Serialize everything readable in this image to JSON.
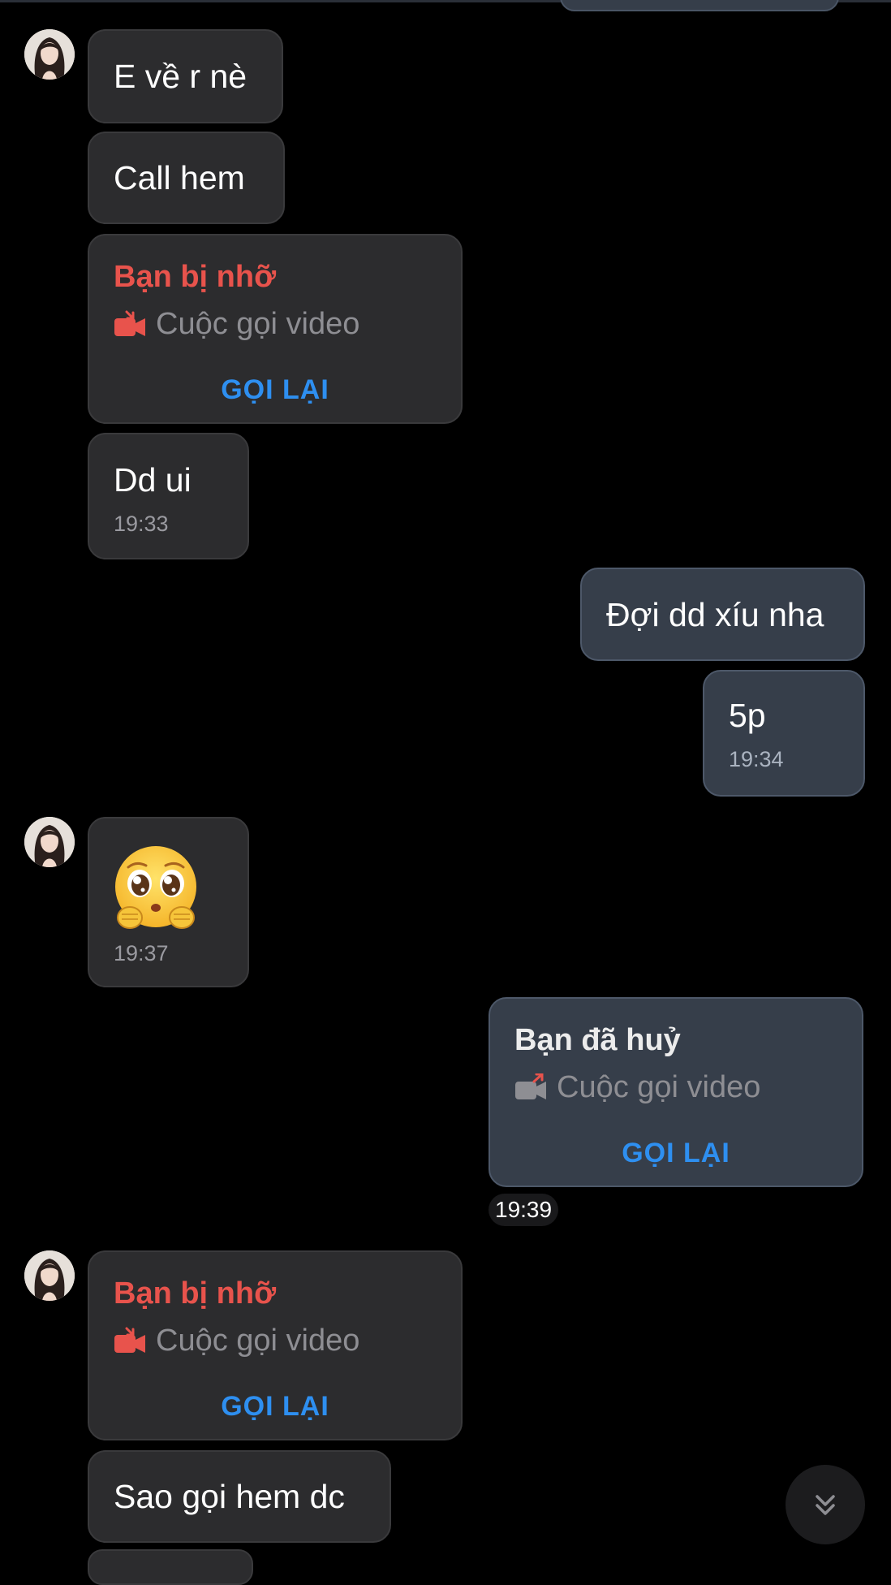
{
  "colors": {
    "background": "#000000",
    "incoming_bubble": "#2c2c2e",
    "outgoing_bubble": "#363e4a",
    "missed_call": "#e8534c",
    "call_back_link": "#2e8ff0",
    "timestamp": "#9a9aa0"
  },
  "messages": [
    {
      "direction": "incoming",
      "text": "E về r nè"
    },
    {
      "direction": "incoming",
      "text": "Call hem"
    },
    {
      "direction": "incoming",
      "type": "call",
      "title": "Bạn bị nhỡ",
      "label": "Cuộc gọi video",
      "action": "GỌI LẠI",
      "icon": "missed-video-call-icon"
    },
    {
      "direction": "incoming",
      "text": "Dd ui",
      "time": "19:33"
    },
    {
      "direction": "outgoing",
      "text": "Đợi dd xíu nha"
    },
    {
      "direction": "outgoing",
      "text": "5p",
      "time": "19:34"
    },
    {
      "direction": "incoming",
      "type": "emoji",
      "emoji": "🥺",
      "icon": "pleading-face-emoji",
      "time": "19:37"
    },
    {
      "direction": "outgoing",
      "type": "call",
      "title": "Bạn đã huỷ",
      "label": "Cuộc gọi video",
      "action": "GỌI LẠI",
      "icon": "outgoing-video-call-icon",
      "time": "19:39"
    },
    {
      "direction": "incoming",
      "type": "call",
      "title": "Bạn bị nhỡ",
      "label": "Cuộc gọi video",
      "action": "GỌI LẠI",
      "icon": "missed-video-call-icon"
    },
    {
      "direction": "incoming",
      "text": "Sao gọi hem dc"
    }
  ],
  "scroll_button": {
    "icon": "double-chevron-down-icon"
  }
}
